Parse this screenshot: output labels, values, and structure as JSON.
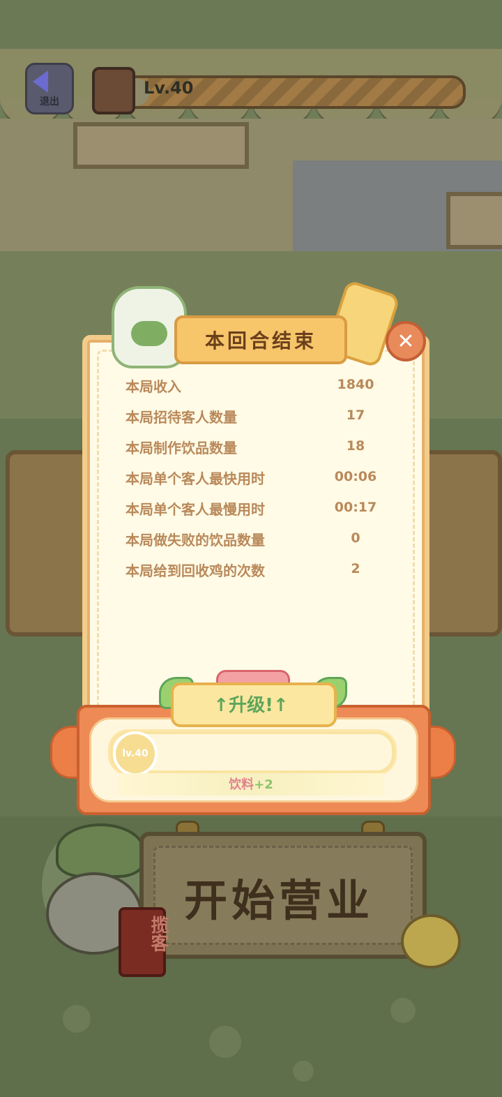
{
  "hud": {
    "exit_label": "退出",
    "level": "Lv.40"
  },
  "modal": {
    "title": "本回合结束",
    "stats": [
      {
        "label": "本局收入",
        "value": "1840"
      },
      {
        "label": "本局招待客人数量",
        "value": "17"
      },
      {
        "label": "本局制作饮品数量",
        "value": "18"
      },
      {
        "label": "本局单个客人最快用时",
        "value": "00:06"
      },
      {
        "label": "本局单个客人最慢用时",
        "value": "00:17"
      },
      {
        "label": "本局做失败的饮品数量",
        "value": "0"
      },
      {
        "label": "本局给到回收鸡的次数",
        "value": "2"
      }
    ],
    "upgrade": {
      "banner": "↑升级!↑",
      "level": "lv.40",
      "reward_label": "饮料",
      "reward_amount": "+2"
    }
  },
  "bottom": {
    "start_button": "开始营业",
    "solicit_tag": "揽客"
  }
}
